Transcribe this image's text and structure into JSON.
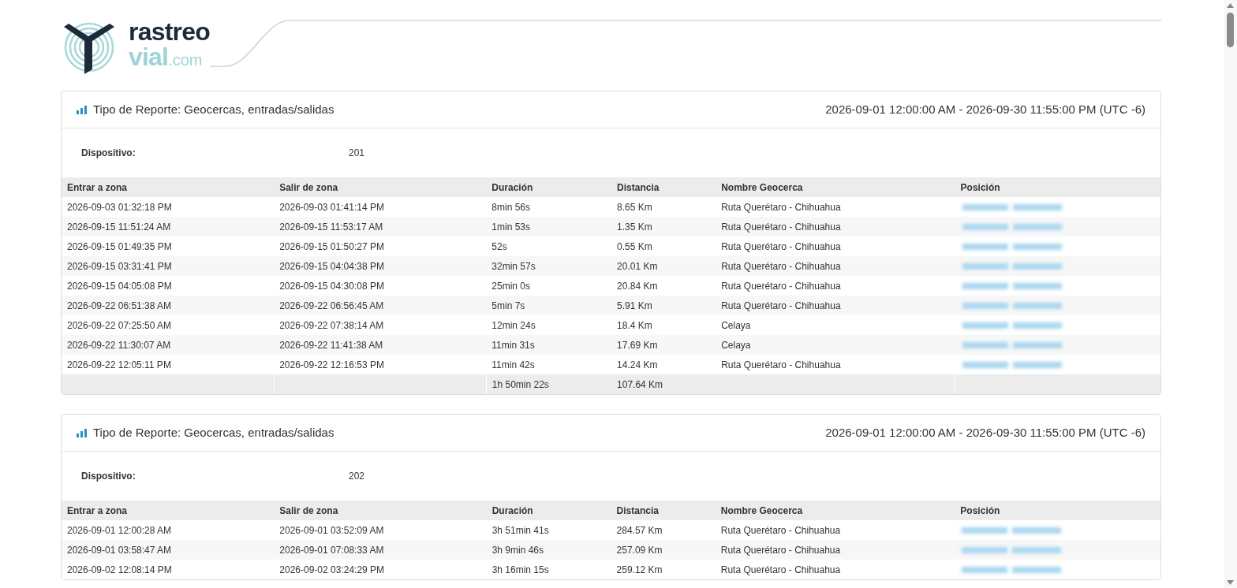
{
  "logo": {
    "line1": "rastreo",
    "line2_main": "vial",
    "line2_suffix": ".com"
  },
  "reports": [
    {
      "title": "Tipo de Reporte: Geocercas, entradas/salidas",
      "range": "2026-09-01 12:00:00 AM - 2026-09-30 11:55:00 PM (UTC -6)",
      "device_label": "Dispositivo:",
      "device": "201",
      "columns": [
        "Entrar a zona",
        "Salir de zona",
        "Duración",
        "Distancia",
        "Nombre Geocerca",
        "Posición"
      ],
      "rows": [
        [
          "2026-09-03 01:32:18 PM",
          "2026-09-03 01:41:14 PM",
          "8min 56s",
          "8.65 Km",
          "Ruta Querétaro - Chihuahua"
        ],
        [
          "2026-09-15 11:51:24 AM",
          "2026-09-15 11:53:17 AM",
          "1min 53s",
          "1.35 Km",
          "Ruta Querétaro - Chihuahua"
        ],
        [
          "2026-09-15 01:49:35 PM",
          "2026-09-15 01:50:27 PM",
          "52s",
          "0.55 Km",
          "Ruta Querétaro - Chihuahua"
        ],
        [
          "2026-09-15 03:31:41 PM",
          "2026-09-15 04:04:38 PM",
          "32min 57s",
          "20.01 Km",
          "Ruta Querétaro - Chihuahua"
        ],
        [
          "2026-09-15 04:05:08 PM",
          "2026-09-15 04:30:08 PM",
          "25min 0s",
          "20.84 Km",
          "Ruta Querétaro - Chihuahua"
        ],
        [
          "2026-09-22 06:51:38 AM",
          "2026-09-22 06:56:45 AM",
          "5min 7s",
          "5.91 Km",
          "Ruta Querétaro - Chihuahua"
        ],
        [
          "2026-09-22 07:25:50 AM",
          "2026-09-22 07:38:14 AM",
          "12min 24s",
          "18.4 Km",
          "Celaya"
        ],
        [
          "2026-09-22 11:30:07 AM",
          "2026-09-22 11:41:38 AM",
          "11min 31s",
          "17.69 Km",
          "Celaya"
        ],
        [
          "2026-09-22 12:05:11 PM",
          "2026-09-22 12:16:53 PM",
          "11min 42s",
          "14.24 Km",
          "Ruta Querétaro - Chihuahua"
        ]
      ],
      "totals": {
        "duration": "1h 50min 22s",
        "distance": "107.64 Km"
      }
    },
    {
      "title": "Tipo de Reporte: Geocercas, entradas/salidas",
      "range": "2026-09-01 12:00:00 AM - 2026-09-30 11:55:00 PM (UTC -6)",
      "device_label": "Dispositivo:",
      "device": "202",
      "columns": [
        "Entrar a zona",
        "Salir de zona",
        "Duración",
        "Distancia",
        "Nombre Geocerca",
        "Posición"
      ],
      "rows": [
        [
          "2026-09-01 12:00:28 AM",
          "2026-09-01 03:52:09 AM",
          "3h 51min 41s",
          "284.57 Km",
          "Ruta Querétaro - Chihuahua"
        ],
        [
          "2026-09-01 03:58:47 AM",
          "2026-09-01 07:08:33 AM",
          "3h 9min 46s",
          "257.09 Km",
          "Ruta Querétaro - Chihuahua"
        ],
        [
          "2026-09-02 12:08:14 PM",
          "2026-09-02 03:24:29 PM",
          "3h 16min 15s",
          "259.12 Km",
          "Ruta Querétaro - Chihuahua"
        ]
      ]
    }
  ]
}
